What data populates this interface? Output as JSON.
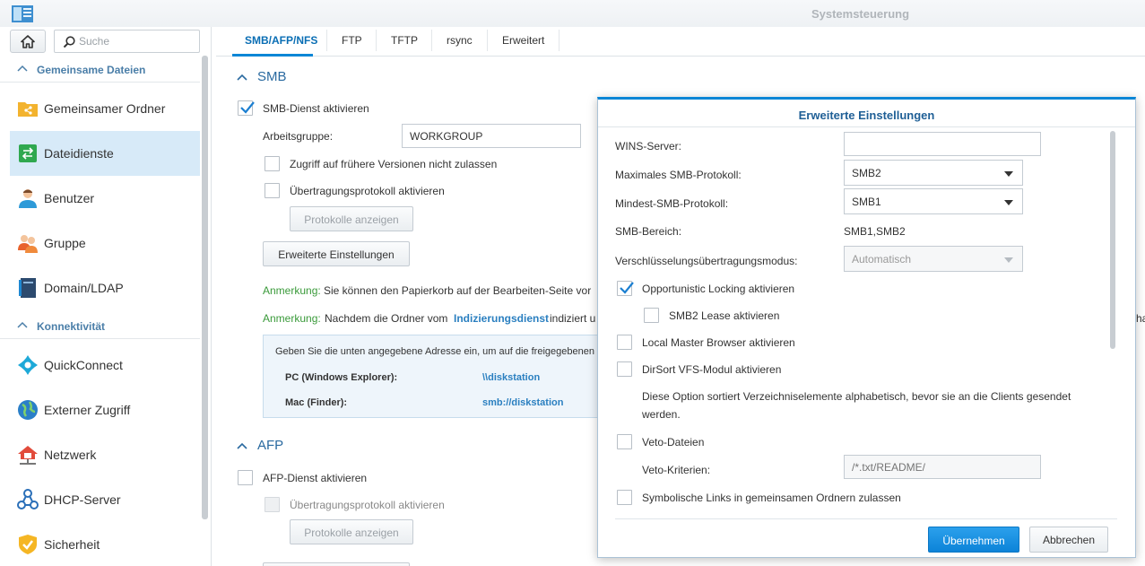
{
  "window": {
    "title": "Systemsteuerung"
  },
  "sidebar": {
    "search_placeholder": "Suche",
    "sections": [
      {
        "label": "Gemeinsame Dateien"
      },
      {
        "label": "Konnektivität"
      }
    ],
    "items": [
      {
        "label": "Gemeinsamer Ordner",
        "icon": "shared-folder-icon"
      },
      {
        "label": "Dateidienste",
        "icon": "file-services-icon",
        "active": true
      },
      {
        "label": "Benutzer",
        "icon": "user-icon"
      },
      {
        "label": "Gruppe",
        "icon": "group-icon"
      },
      {
        "label": "Domain/LDAP",
        "icon": "domain-ldap-icon"
      },
      {
        "label": "QuickConnect",
        "icon": "quickconnect-icon"
      },
      {
        "label": "Externer Zugriff",
        "icon": "external-access-icon"
      },
      {
        "label": "Netzwerk",
        "icon": "network-icon"
      },
      {
        "label": "DHCP-Server",
        "icon": "dhcp-server-icon"
      },
      {
        "label": "Sicherheit",
        "icon": "security-icon"
      }
    ]
  },
  "tabs": [
    "SMB/AFP/NFS",
    "FTP",
    "TFTP",
    "rsync",
    "Erweitert"
  ],
  "smb": {
    "title": "SMB",
    "enable_label": "SMB-Dienst aktivieren",
    "workgroup_label": "Arbeitsgruppe:",
    "workgroup_value": "WORKGROUP",
    "prev_versions_label": "Zugriff auf frühere Versionen nicht zulassen",
    "transfer_log_label": "Übertragungsprotokoll aktivieren",
    "show_logs_button": "Protokolle anzeigen",
    "advanced_button": "Erweiterte Einstellungen",
    "note1_prefix": "Anmerkung:",
    "note1_text": "Sie können den Papierkorb auf der Bearbeiten-Seite vor",
    "note2_prefix": "Anmerkung:",
    "note2_text": "Nachdem die Ordner vom",
    "note2_link": "Indizierungsdienst",
    "note2_text2": "indiziert u",
    "note2_overflow": "ha",
    "info_intro": "Geben Sie die unten angegebene Adresse ein, um auf die freigegebenen O",
    "pc_label": "PC (Windows Explorer):",
    "pc_value": "\\\\diskstation",
    "mac_label": "Mac (Finder):",
    "mac_value": "smb://diskstation"
  },
  "afp": {
    "title": "AFP",
    "enable_label": "AFP-Dienst aktivieren",
    "transfer_log_label": "Übertragungsprotokoll aktivieren",
    "show_logs_button": "Protokolle anzeigen"
  },
  "dialog": {
    "title": "Erweiterte Einstellungen",
    "wins_label": "WINS-Server:",
    "wins_value": "",
    "max_smb_label": "Maximales SMB-Protokoll:",
    "max_smb_value": "SMB2",
    "min_smb_label": "Mindest-SMB-Protokoll:",
    "min_smb_value": "SMB1",
    "smb_range_label": "SMB-Bereich:",
    "smb_range_value": "SMB1,SMB2",
    "encryption_label": "Verschlüsselungsübertragungsmodus:",
    "encryption_value": "Automatisch",
    "oplock_label": "Opportunistic Locking aktivieren",
    "smb2_lease_label": "SMB2 Lease aktivieren",
    "local_master_label": "Local Master Browser aktivieren",
    "dirsort_label": "DirSort VFS-Modul aktivieren",
    "dirsort_desc_1": "Diese Option sortiert Verzeichniselemente alphabetisch, bevor sie an die Clients gesendet",
    "dirsort_desc_2": "werden.",
    "veto_label": "Veto-Dateien",
    "veto_criteria_label": "Veto-Kriterien:",
    "veto_criteria_placeholder": "/*.txt/README/",
    "symlinks_label": "Symbolische Links in gemeinsamen Ordnern zulassen",
    "apply_button": "Übernehmen",
    "cancel_button": "Abbrechen"
  },
  "colors": {
    "accent": "#0a86d6",
    "active_bg": "#d7eaf8",
    "note_green": "#3a9a3a"
  }
}
